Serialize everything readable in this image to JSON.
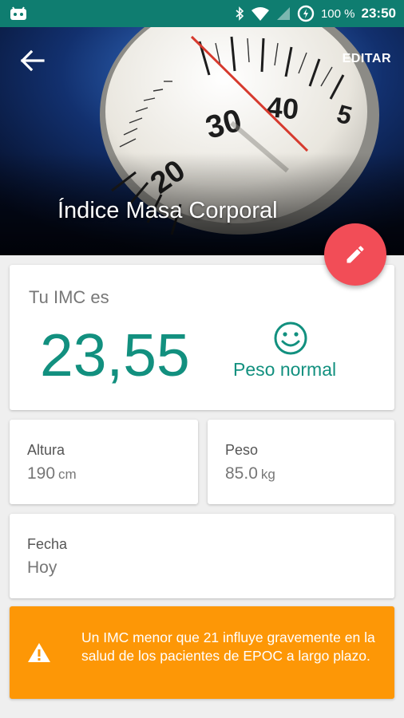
{
  "statusbar": {
    "battery": "100 %",
    "time": "23:50"
  },
  "header": {
    "title": "Índice Masa Corporal",
    "edit_label": "EDITAR"
  },
  "imc": {
    "label": "Tu IMC es",
    "value": "23,55",
    "status": "Peso normal",
    "accent_color": "#12907f"
  },
  "altura": {
    "label": "Altura",
    "value": "190",
    "unit": "cm"
  },
  "peso": {
    "label": "Peso",
    "value": "85.0",
    "unit": "kg"
  },
  "fecha": {
    "label": "Fecha",
    "value": "Hoy"
  },
  "warning": {
    "text": "Un IMC menor que 21 influye gravemente en la salud de los pacientes de EPOC a largo plazo.",
    "color": "#fd9706"
  },
  "scale_ticks": [
    "20",
    "30",
    "40",
    "5"
  ],
  "colors": {
    "statusbar": "#0f7d70",
    "fab": "#f24d57"
  }
}
